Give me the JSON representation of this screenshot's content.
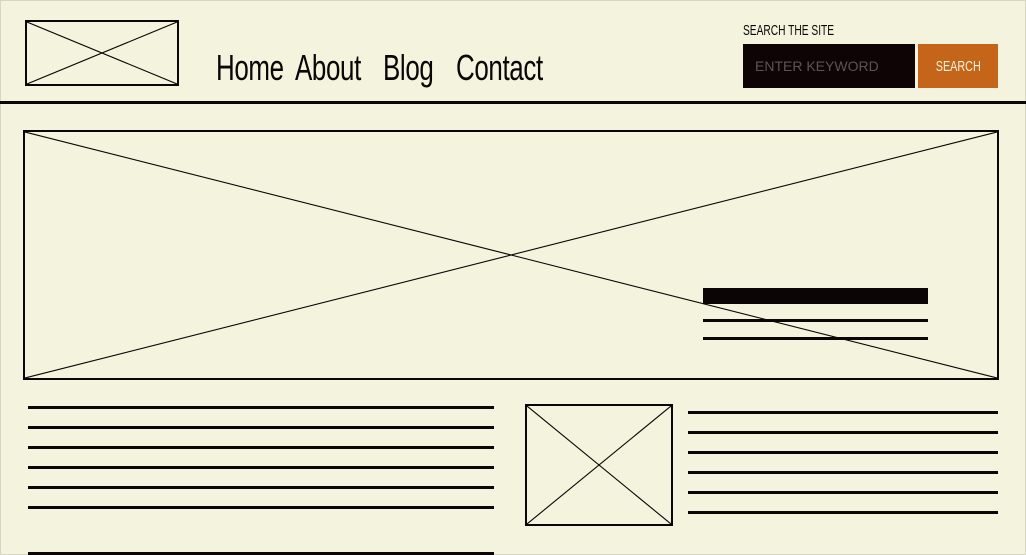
{
  "nav": {
    "items": [
      {
        "label": "Home"
      },
      {
        "label": "About"
      },
      {
        "label": "Blog"
      },
      {
        "label": "Contact"
      }
    ]
  },
  "search": {
    "label": "SEARCH THE SITE",
    "placeholder": "ENTER KEYWORD",
    "button_label": "SEARCH"
  },
  "colors": {
    "background": "#f4f3de",
    "ink": "#0b0505",
    "accent": "#c4651a",
    "input_bg": "#0e0405"
  },
  "icons": {
    "logo": "image-placeholder-icon",
    "hero": "image-placeholder-icon",
    "thumbnail": "image-placeholder-icon"
  }
}
